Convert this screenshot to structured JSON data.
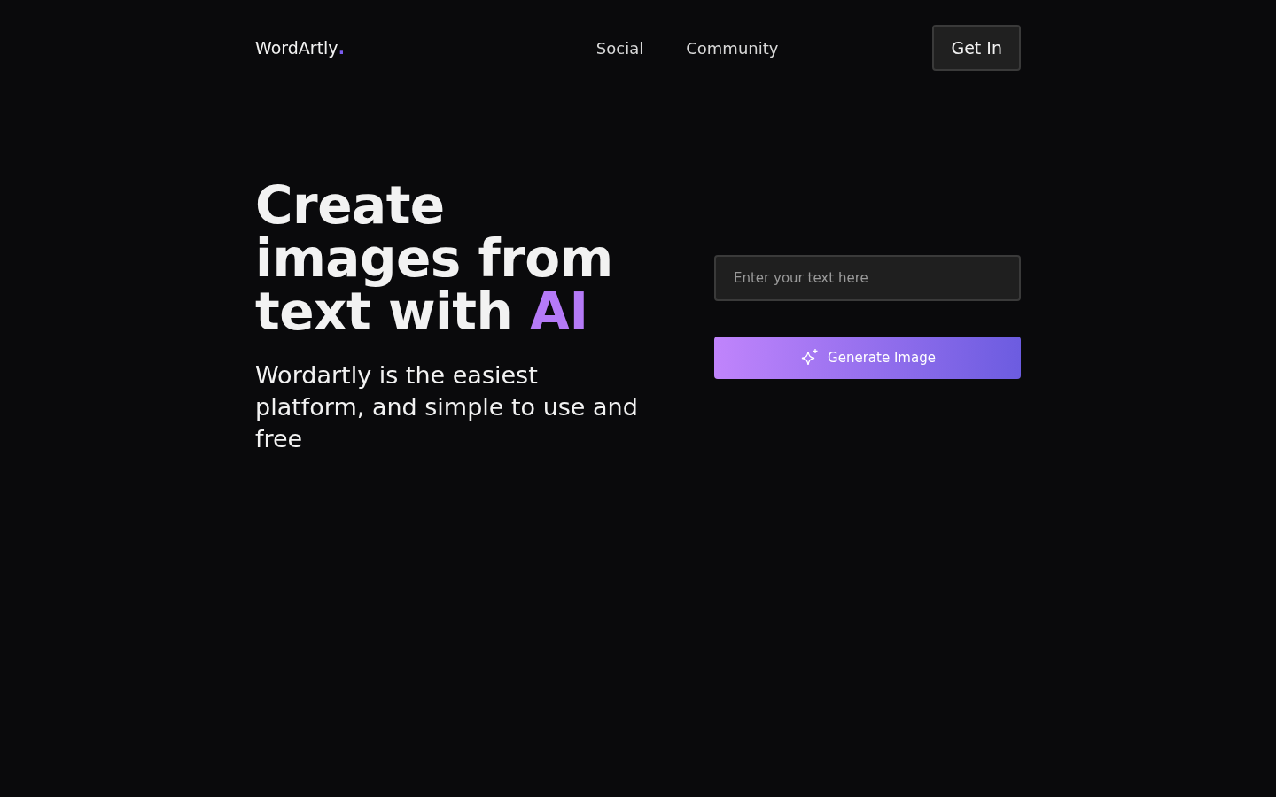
{
  "nav": {
    "brand": "WordArtly",
    "brand_dot": ".",
    "links": [
      {
        "label": "Social"
      },
      {
        "label": "Community"
      }
    ],
    "button": "Get In"
  },
  "hero": {
    "headline": "Create images from text with",
    "headline_accent": "AI",
    "subtitle": "Wordartly is the easiest platform, and simple to use and free"
  },
  "form": {
    "placeholder": "Enter your text here",
    "button": "Generate Image"
  }
}
